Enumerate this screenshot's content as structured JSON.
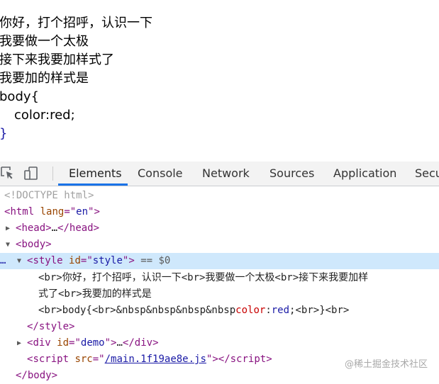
{
  "page": {
    "lines": [
      "你好，打个招呼，认识一下",
      "我要做一个太极",
      "接下来我要加样式了",
      "我要加的样式是",
      "body{",
      "color:red;",
      "}"
    ]
  },
  "devtools": {
    "tabs": [
      "Elements",
      "Console",
      "Network",
      "Sources",
      "Application",
      "Secu"
    ],
    "active_tab": "Elements",
    "dom": {
      "doctype": "<!DOCTYPE html>",
      "html_tag": "html",
      "html_attr_name": "lang",
      "html_attr_value": "en",
      "head_tag": "head",
      "ellipsis": "…",
      "body_tag": "body",
      "style_tag": "style",
      "style_attr_name": "id",
      "style_attr_value": "style",
      "selected_marker": "== $0",
      "style_text_line1": "<br>你好，打个招呼，认识一下<br>我要做一个太极<br>接下来我要加样",
      "style_text_line2": "式了<br>我要加的样式是",
      "style_text_line3_a": "<br>body{<br>&nbsp&nbsp&nbsp&nbsp",
      "style_text_line3_prop": "color",
      "style_text_line3_colon": ":",
      "style_text_line3_val": "red",
      "style_text_line3_b": ";<br>}<br>",
      "div_tag": "div",
      "div_attr_name": "id",
      "div_attr_value": "demo",
      "script_tag": "script",
      "script_attr_name": "src",
      "script_src": "/main.1f19ae8e.js",
      "body_close": "</body>"
    }
  },
  "watermark": "@稀土掘金技术社区",
  "colors": {
    "accent": "#1a73e8",
    "selected_row": "#cfe8fc",
    "tag": "#881280"
  },
  "icons": [
    "inspect-element-icon",
    "device-toolbar-icon"
  ]
}
